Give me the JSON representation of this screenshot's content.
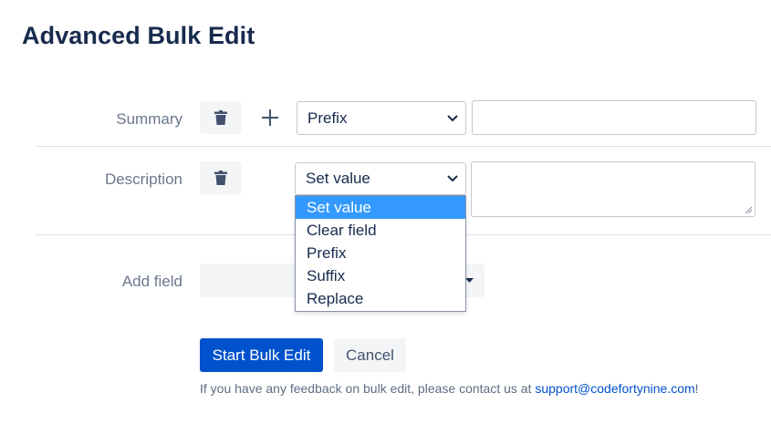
{
  "page": {
    "title": "Advanced Bulk Edit"
  },
  "fields": [
    {
      "label": "Summary",
      "operation": "Prefix",
      "value": "",
      "delete_icon": "trash-icon",
      "add_icon": "plus-icon"
    },
    {
      "label": "Description",
      "operation": "Set value",
      "value": "",
      "delete_icon": "trash-icon"
    }
  ],
  "operation_dropdown": {
    "options": [
      "Set value",
      "Clear field",
      "Prefix",
      "Suffix",
      "Replace"
    ],
    "selected": "Set value"
  },
  "add_field": {
    "label": "Add field",
    "value": ""
  },
  "actions": {
    "start_label": "Start Bulk Edit",
    "cancel_label": "Cancel"
  },
  "feedback": {
    "text": "If you have any feedback on bulk edit, please contact us at ",
    "email": "support@codefortynine.com",
    "suffix": "!"
  },
  "colors": {
    "primary": "#0052cc",
    "selected_option": "#3399ff",
    "heading": "#172b4d",
    "label": "#6b778c"
  }
}
